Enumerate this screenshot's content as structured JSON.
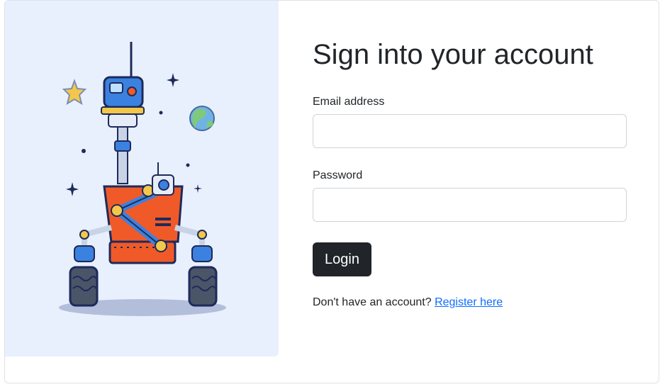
{
  "login": {
    "title": "Sign into your account",
    "email_label": "Email address",
    "email_value": "",
    "password_label": "Password",
    "password_value": "",
    "submit_label": "Login",
    "register_prompt": "Don't have an account?",
    "register_link": "Register here"
  },
  "illustration": {
    "icon": "robot-rover-icon"
  },
  "colors": {
    "illustration_bg": "#e8f0fe",
    "button_bg": "#212529",
    "link": "#0d6efd",
    "robot_body": "#f05a28",
    "robot_blue": "#3b82e0"
  }
}
